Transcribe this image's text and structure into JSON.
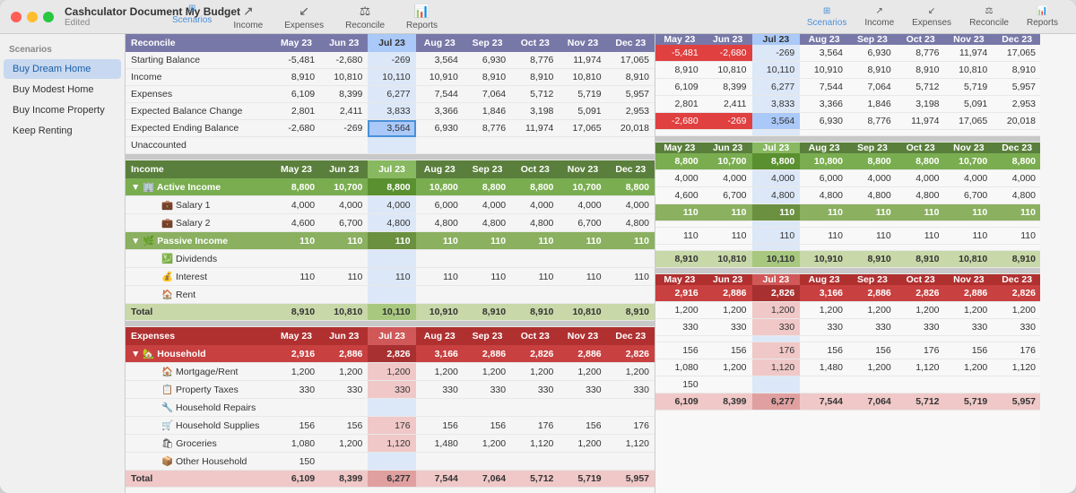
{
  "window": {
    "title": "Cashculator Document My Budget",
    "subtitle": "Edited"
  },
  "toolbar": {
    "left_items": [
      {
        "label": "Scenarios",
        "icon": "⊞",
        "active": true
      },
      {
        "label": "Income",
        "icon": "↗",
        "active": false
      },
      {
        "label": "Expenses",
        "icon": "↙",
        "active": false
      },
      {
        "label": "Reconcile",
        "icon": "⚖",
        "active": false
      },
      {
        "label": "Reports",
        "icon": "📊",
        "active": false
      }
    ],
    "right_items": [
      {
        "label": "Scenarios",
        "icon": "⊞",
        "active": true
      },
      {
        "label": "Income",
        "icon": "↗",
        "active": false
      },
      {
        "label": "Expenses",
        "icon": "↙",
        "active": false
      },
      {
        "label": "Reconcile",
        "icon": "⚖",
        "active": false
      },
      {
        "label": "Reports",
        "icon": "📊",
        "active": false
      }
    ]
  },
  "sidebar": {
    "label": "Scenarios",
    "items": [
      {
        "label": "Buy Dream Home",
        "active": true
      },
      {
        "label": "Buy Modest Home",
        "active": false
      },
      {
        "label": "Buy Income Property",
        "active": false
      },
      {
        "label": "Keep Renting",
        "active": false
      }
    ]
  },
  "reconcile": {
    "header": "Reconcile",
    "columns": [
      "May 23",
      "Jun 23",
      "Jul 23",
      "Aug 23",
      "Sep 23",
      "Oct 23",
      "Nov 23",
      "Dec 23"
    ],
    "rows": [
      {
        "label": "Starting Balance",
        "values": [
          "-5,481",
          "-2,680",
          "-269",
          "3,564",
          "6,930",
          "8,776",
          "11,974",
          "17,065"
        ]
      },
      {
        "label": "Income",
        "values": [
          "8,910",
          "10,810",
          "10,110",
          "10,910",
          "8,910",
          "8,910",
          "10,810",
          "8,910"
        ]
      },
      {
        "label": "Expenses",
        "values": [
          "6,109",
          "8,399",
          "6,277",
          "7,544",
          "7,064",
          "5,712",
          "5,719",
          "5,957"
        ]
      },
      {
        "label": "Expected Balance Change",
        "values": [
          "2,801",
          "2,411",
          "3,833",
          "3,366",
          "1,846",
          "3,198",
          "5,091",
          "2,953"
        ]
      },
      {
        "label": "Expected Ending Balance",
        "values": [
          "-2,680",
          "-269",
          "3,564",
          "6,930",
          "8,776",
          "11,974",
          "17,065",
          "20,018"
        ]
      },
      {
        "label": "Unaccounted",
        "values": [
          "",
          "",
          "",
          "",
          "",
          "",
          "",
          ""
        ]
      }
    ]
  },
  "income": {
    "header": "Income",
    "columns": [
      "May 23",
      "Jun 23",
      "Jul 23",
      "Aug 23",
      "Sep 23",
      "Oct 23",
      "Nov 23",
      "Dec 23"
    ],
    "active_income": {
      "label": "Active Income",
      "values": [
        "8,800",
        "10,700",
        "8,800",
        "10,800",
        "8,800",
        "8,800",
        "10,700",
        "8,800"
      ],
      "children": [
        {
          "label": "Salary 1",
          "values": [
            "4,000",
            "4,000",
            "4,000",
            "6,000",
            "4,000",
            "4,000",
            "4,000",
            "4,000"
          ]
        },
        {
          "label": "Salary 2",
          "values": [
            "4,600",
            "6,700",
            "4,800",
            "4,800",
            "4,800",
            "4,800",
            "6,700",
            "4,800"
          ]
        }
      ]
    },
    "passive_income": {
      "label": "Passive Income",
      "values": [
        "110",
        "110",
        "110",
        "110",
        "110",
        "110",
        "110",
        "110"
      ],
      "children": [
        {
          "label": "Dividends",
          "values": [
            "",
            "",
            "",
            "",
            "",
            "",
            "",
            ""
          ]
        },
        {
          "label": "Interest",
          "values": [
            "110",
            "110",
            "110",
            "110",
            "110",
            "110",
            "110",
            "110"
          ]
        },
        {
          "label": "Rent",
          "values": [
            "",
            "",
            "",
            "",
            "",
            "",
            "",
            ""
          ]
        }
      ]
    },
    "total": {
      "label": "Total",
      "values": [
        "8,910",
        "10,810",
        "10,110",
        "10,910",
        "8,910",
        "8,910",
        "10,810",
        "8,910"
      ]
    }
  },
  "expenses": {
    "header": "Expenses",
    "columns": [
      "May 23",
      "Jun 23",
      "Jul 23",
      "Aug 23",
      "Sep 23",
      "Oct 23",
      "Nov 23",
      "Dec 23"
    ],
    "household": {
      "label": "Household",
      "values": [
        "2,916",
        "2,886",
        "2,826",
        "3,166",
        "2,886",
        "2,826",
        "2,886",
        "2,826"
      ],
      "children": [
        {
          "label": "Mortgage/Rent",
          "values": [
            "1,200",
            "1,200",
            "1,200",
            "1,200",
            "1,200",
            "1,200",
            "1,200",
            "1,200"
          ]
        },
        {
          "label": "Property Taxes",
          "values": [
            "330",
            "330",
            "330",
            "330",
            "330",
            "330",
            "330",
            "330"
          ]
        },
        {
          "label": "Household Repairs",
          "values": [
            "",
            "",
            "",
            "",
            "",
            "",
            "",
            ""
          ]
        },
        {
          "label": "Household Supplies",
          "values": [
            "156",
            "156",
            "176",
            "156",
            "156",
            "176",
            "156",
            "176"
          ]
        },
        {
          "label": "Groceries",
          "values": [
            "1,080",
            "1,200",
            "1,120",
            "1,480",
            "1,200",
            "1,120",
            "1,200",
            "1,120"
          ]
        },
        {
          "label": "Other Household",
          "values": [
            "150",
            "",
            "",
            "",
            "",
            "",
            "",
            ""
          ]
        }
      ]
    },
    "total": {
      "label": "Total",
      "values": [
        "6,109",
        "8,399",
        "6,277",
        "7,544",
        "7,064",
        "5,712",
        "5,719",
        "5,957"
      ]
    }
  },
  "oct_col_index": 5,
  "jul_col_index": 2
}
